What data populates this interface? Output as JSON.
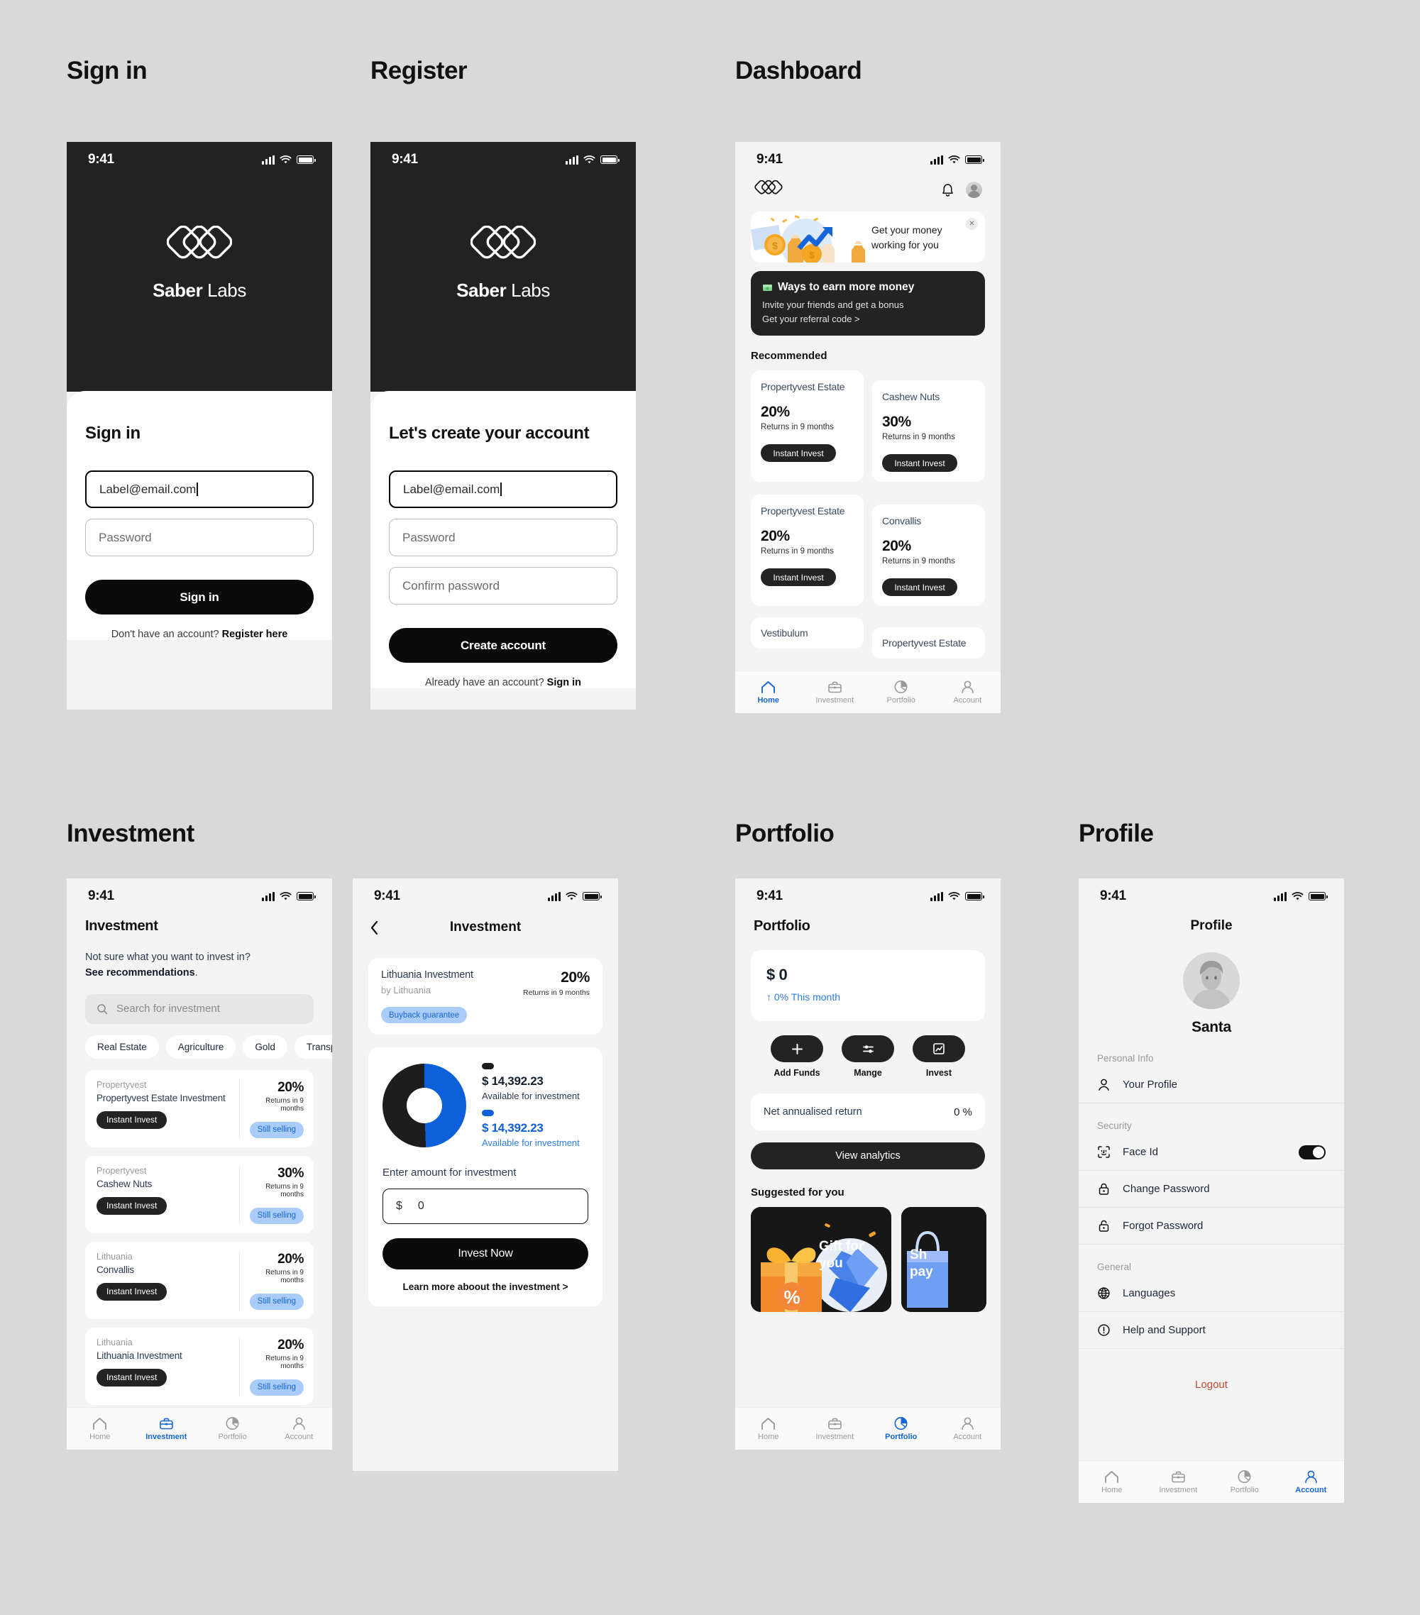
{
  "sections": {
    "signin": "Sign in",
    "register": "Register",
    "dashboard": "Dashboard",
    "investment": "Investment",
    "portfolio": "Portfolio",
    "profile": "Profile"
  },
  "status_bar": {
    "time": "9:41"
  },
  "brand": {
    "bold": "Saber",
    "light": "Labs"
  },
  "signin_screen": {
    "heading": "Sign in",
    "email_value": "Label@email.com",
    "password_placeholder": "Password",
    "submit_label": "Sign in",
    "footer_prefix": "Don't have an account?",
    "footer_link": "Register here"
  },
  "register_screen": {
    "heading": "Let's create your account",
    "email_value": "Label@email.com",
    "password_placeholder": "Password",
    "confirm_placeholder": "Confirm password",
    "submit_label": "Create account",
    "footer_prefix": "Already have an account?",
    "footer_link": "Sign in"
  },
  "dashboard_screen": {
    "promo": {
      "line1": "Get your money",
      "line2": "working for you",
      "close_icon": "close-icon"
    },
    "earn": {
      "title": "Ways to earn more money",
      "subtitle": "Invite your friends and get a bonus",
      "link": "Get your referral code >"
    },
    "recommended_heading": "Recommended",
    "recommended": [
      {
        "name": "Propertyvest Estate",
        "pct": "20%",
        "returns": "Returns in 9 months",
        "cta": "Instant Invest"
      },
      {
        "name": "Cashew Nuts",
        "pct": "30%",
        "returns": "Returns in 9 months",
        "cta": "Instant Invest"
      },
      {
        "name": "Propertyvest Estate",
        "pct": "20%",
        "returns": "Returns in 9 months",
        "cta": "Instant Invest"
      },
      {
        "name": "Convallis",
        "pct": "20%",
        "returns": "Returns in 9 months",
        "cta": "Instant Invest"
      },
      {
        "name": "Vestibulum",
        "pct": "",
        "returns": "",
        "cta": ""
      },
      {
        "name": "Propertyvest Estate",
        "pct": "",
        "returns": "",
        "cta": ""
      }
    ]
  },
  "investment_screen": {
    "title": "Investment",
    "lead_line1": "Not sure what you want to invest in?",
    "lead_line2": "See recommendations",
    "lead_period": ".",
    "search_placeholder": "Search for investment",
    "categories": [
      "Real Estate",
      "Agriculture",
      "Gold",
      "Transport"
    ],
    "list": [
      {
        "company": "Propertyvest",
        "name": "Propertyvest Estate Investment",
        "pct": "20%",
        "returns": "Returns in 9 months",
        "cta": "Instant Invest",
        "status": "Still selling"
      },
      {
        "company": "Propertyvest",
        "name": "Cashew Nuts",
        "pct": "30%",
        "returns": "Returns in 9 months",
        "cta": "Instant Invest",
        "status": "Still selling"
      },
      {
        "company": "Lithuania",
        "name": "Convallis",
        "pct": "20%",
        "returns": "Returns in 9 months",
        "cta": "Instant Invest",
        "status": "Still selling"
      },
      {
        "company": "Lithuania",
        "name": "Lithuania Investment",
        "pct": "20%",
        "returns": "Returns in 9 months",
        "cta": "Instant Invest",
        "status": "Still selling"
      }
    ]
  },
  "investment_detail_screen": {
    "title": "Investment",
    "back_icon": "chevron-left-icon",
    "name": "Lithuania Investment",
    "by": "by Lithuania",
    "pct": "20%",
    "returns": "Returns in 9 months",
    "badge": "Buyback guarantee",
    "legend": [
      {
        "amount": "$ 14,392.23",
        "label": "Available for investment",
        "color": "#1d1d1d"
      },
      {
        "amount": "$ 14,392.23",
        "label": "Available for investment",
        "color": "#0d60da"
      }
    ],
    "amount_heading": "Enter amount for investment",
    "amount_currency": "$",
    "amount_value": "0",
    "submit_label": "Invest Now",
    "learn_more": "Learn more aboout the investment >"
  },
  "portfolio_screen": {
    "title": "Portfolio",
    "balance": "$ 0",
    "change": "↑ 0% This month",
    "actions": [
      {
        "label": "Add Funds",
        "icon": "plus-icon"
      },
      {
        "label": "Mange",
        "icon": "sliders-icon"
      },
      {
        "label": "Invest",
        "icon": "chart-box-icon"
      }
    ],
    "return_label": "Net annualised return",
    "return_value": "0 %",
    "view_analytics": "View analytics",
    "suggested_heading": "Suggested for you",
    "suggested": [
      {
        "line1": "Gift for",
        "line2": "you"
      },
      {
        "line1": "Sh",
        "line2": "pay"
      }
    ]
  },
  "profile_screen": {
    "title": "Profile",
    "name": "Santa",
    "groups": [
      {
        "label": "Personal Info",
        "items": [
          {
            "label": "Your Profile",
            "icon": "user-icon",
            "control": "none"
          }
        ]
      },
      {
        "label": "Security",
        "items": [
          {
            "label": "Face Id",
            "icon": "face-id-icon",
            "control": "toggle-on"
          },
          {
            "label": "Change Password",
            "icon": "lock-closed-icon",
            "control": "none"
          },
          {
            "label": "Forgot Password",
            "icon": "lock-open-icon",
            "control": "none"
          }
        ]
      },
      {
        "label": "General",
        "items": [
          {
            "label": "Languages",
            "icon": "globe-icon",
            "control": "none"
          },
          {
            "label": "Help and Support",
            "icon": "info-circle-icon",
            "control": "none"
          }
        ]
      }
    ],
    "logout": "Logout"
  },
  "tabbar": {
    "items": [
      {
        "label": "Home",
        "icon": "home-icon"
      },
      {
        "label": "Investment",
        "icon": "briefcase-icon"
      },
      {
        "label": "Portfolio",
        "icon": "pie-chart-icon"
      },
      {
        "label": "Account",
        "icon": "person-icon"
      }
    ]
  },
  "colors": {
    "accent": "#1565d8",
    "dark": "#232323",
    "blue_chip_bg": "#a9ccfb",
    "logout": "#c0482f"
  }
}
